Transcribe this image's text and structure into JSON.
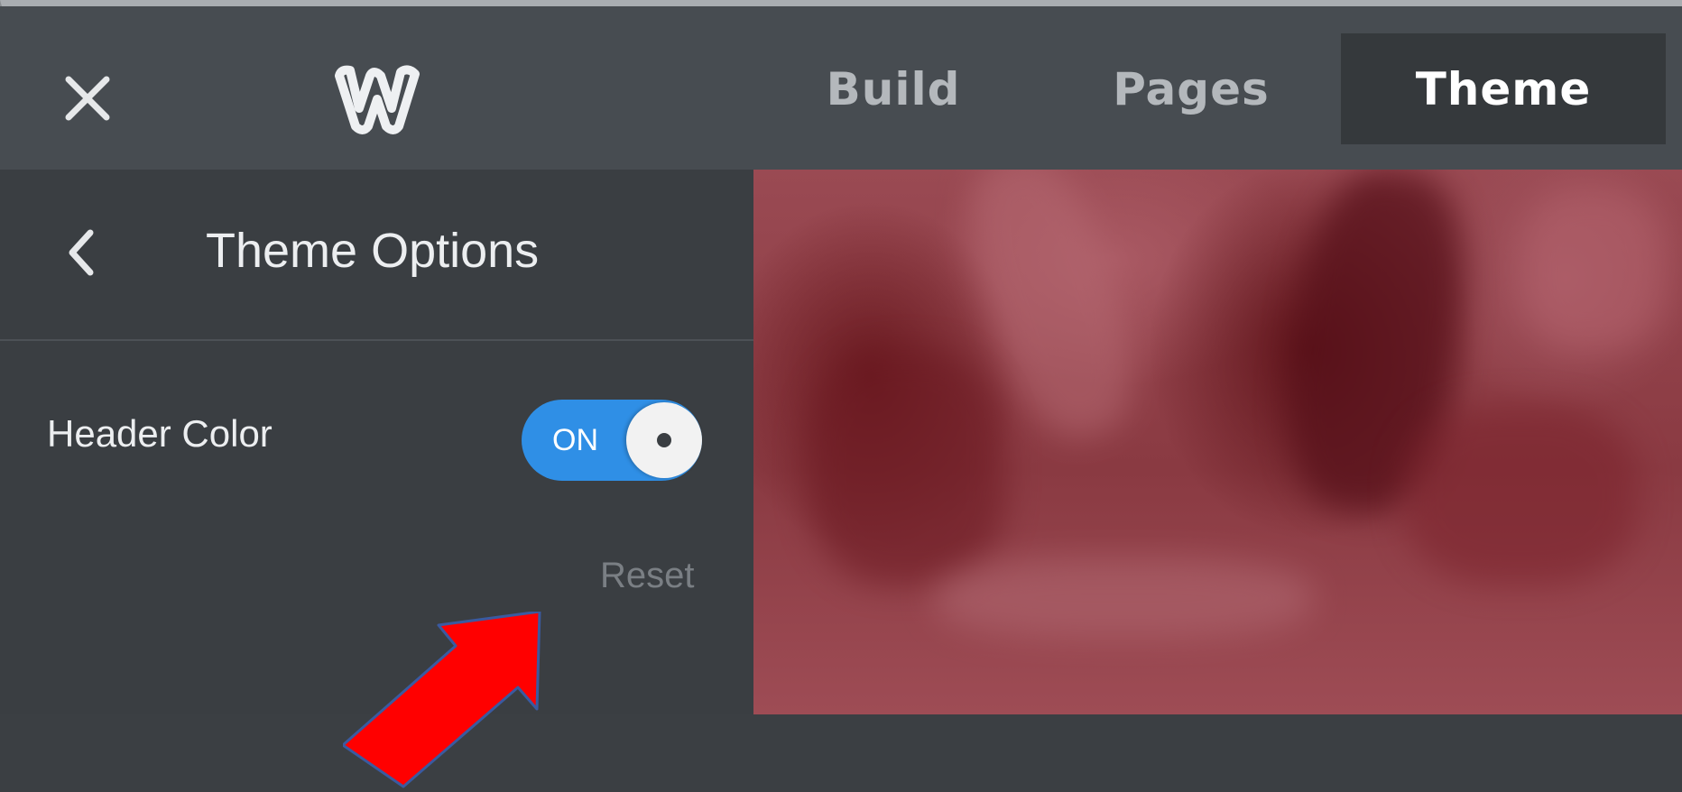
{
  "topbar": {
    "tabs": [
      {
        "label": "Build"
      },
      {
        "label": "Pages"
      },
      {
        "label": "Theme",
        "active": true
      }
    ],
    "icons": {
      "close": "close-icon",
      "logo": "weebly-logo-icon"
    }
  },
  "sidebar": {
    "title": "Theme Options",
    "back_icon": "chevron-left-icon",
    "header_color": {
      "label": "Header Color",
      "toggle_text": "ON",
      "state": "on"
    },
    "reset_label": "Reset"
  },
  "colors": {
    "topbar": "#474c51",
    "sidebar": "#3a3e42",
    "active_tab": "#35393c",
    "toggle_on": "#2f8fe6",
    "annotation_arrow": "#ff0000",
    "preview": "#8a3a42"
  }
}
